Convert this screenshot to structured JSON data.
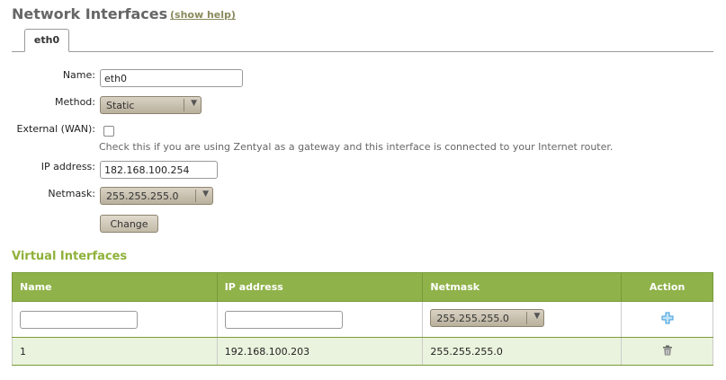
{
  "header": {
    "title": "Network Interfaces",
    "help_link": "(show help)"
  },
  "tabs": [
    {
      "label": "eth0",
      "selected": true
    }
  ],
  "form": {
    "name_label": "Name:",
    "name_value": "eth0",
    "method_label": "Method:",
    "method_value": "Static",
    "external_label": "External (WAN):",
    "external_checked": false,
    "external_hint": "Check this if you are using Zentyal as a gateway and this interface is connected to your Internet router.",
    "ip_label": "IP address:",
    "ip_value": "182.168.100.254",
    "netmask_label": "Netmask:",
    "netmask_value": "255.255.255.0",
    "change_button": "Change"
  },
  "virtual_interfaces": {
    "title": "Virtual Interfaces",
    "columns": [
      "Name",
      "IP address",
      "Netmask",
      "Action"
    ],
    "new_row": {
      "name_value": "",
      "ip_value": "",
      "netmask_value": "255.255.255.0",
      "action_icon": "add-icon"
    },
    "rows": [
      {
        "name": "1",
        "ip": "192.168.100.203",
        "netmask": "255.255.255.0",
        "action_icon": "trash-icon"
      }
    ]
  },
  "colors": {
    "accent_green": "#8fb24a",
    "section_title": "#8fb13a",
    "row_highlight": "#eaf3dd",
    "add_icon": "#3a9ad9"
  }
}
